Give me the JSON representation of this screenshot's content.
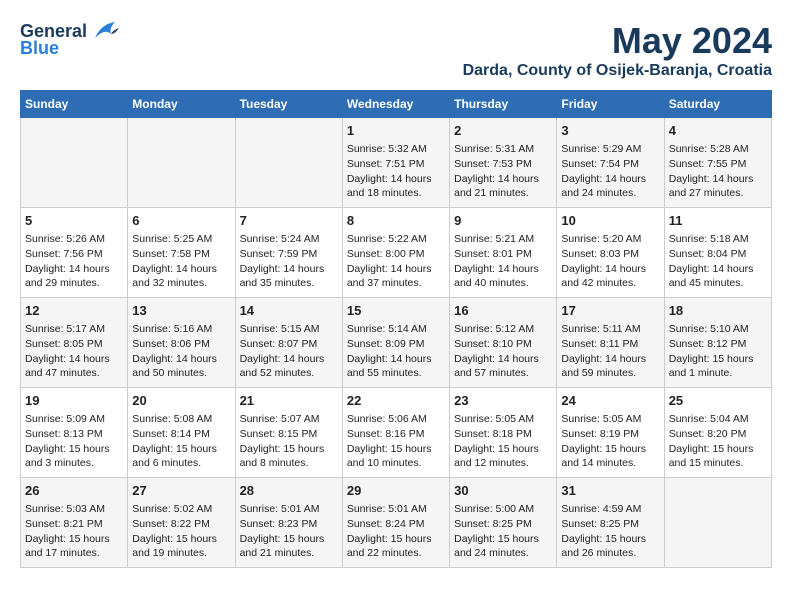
{
  "logo": {
    "general": "General",
    "blue": "Blue"
  },
  "title": {
    "month_year": "May 2024",
    "location": "Darda, County of Osijek-Baranja, Croatia"
  },
  "weekdays": [
    "Sunday",
    "Monday",
    "Tuesday",
    "Wednesday",
    "Thursday",
    "Friday",
    "Saturday"
  ],
  "weeks": [
    [
      {
        "day": "",
        "content": ""
      },
      {
        "day": "",
        "content": ""
      },
      {
        "day": "",
        "content": ""
      },
      {
        "day": "1",
        "content": "Sunrise: 5:32 AM\nSunset: 7:51 PM\nDaylight: 14 hours and 18 minutes."
      },
      {
        "day": "2",
        "content": "Sunrise: 5:31 AM\nSunset: 7:53 PM\nDaylight: 14 hours and 21 minutes."
      },
      {
        "day": "3",
        "content": "Sunrise: 5:29 AM\nSunset: 7:54 PM\nDaylight: 14 hours and 24 minutes."
      },
      {
        "day": "4",
        "content": "Sunrise: 5:28 AM\nSunset: 7:55 PM\nDaylight: 14 hours and 27 minutes."
      }
    ],
    [
      {
        "day": "5",
        "content": "Sunrise: 5:26 AM\nSunset: 7:56 PM\nDaylight: 14 hours and 29 minutes."
      },
      {
        "day": "6",
        "content": "Sunrise: 5:25 AM\nSunset: 7:58 PM\nDaylight: 14 hours and 32 minutes."
      },
      {
        "day": "7",
        "content": "Sunrise: 5:24 AM\nSunset: 7:59 PM\nDaylight: 14 hours and 35 minutes."
      },
      {
        "day": "8",
        "content": "Sunrise: 5:22 AM\nSunset: 8:00 PM\nDaylight: 14 hours and 37 minutes."
      },
      {
        "day": "9",
        "content": "Sunrise: 5:21 AM\nSunset: 8:01 PM\nDaylight: 14 hours and 40 minutes."
      },
      {
        "day": "10",
        "content": "Sunrise: 5:20 AM\nSunset: 8:03 PM\nDaylight: 14 hours and 42 minutes."
      },
      {
        "day": "11",
        "content": "Sunrise: 5:18 AM\nSunset: 8:04 PM\nDaylight: 14 hours and 45 minutes."
      }
    ],
    [
      {
        "day": "12",
        "content": "Sunrise: 5:17 AM\nSunset: 8:05 PM\nDaylight: 14 hours and 47 minutes."
      },
      {
        "day": "13",
        "content": "Sunrise: 5:16 AM\nSunset: 8:06 PM\nDaylight: 14 hours and 50 minutes."
      },
      {
        "day": "14",
        "content": "Sunrise: 5:15 AM\nSunset: 8:07 PM\nDaylight: 14 hours and 52 minutes."
      },
      {
        "day": "15",
        "content": "Sunrise: 5:14 AM\nSunset: 8:09 PM\nDaylight: 14 hours and 55 minutes."
      },
      {
        "day": "16",
        "content": "Sunrise: 5:12 AM\nSunset: 8:10 PM\nDaylight: 14 hours and 57 minutes."
      },
      {
        "day": "17",
        "content": "Sunrise: 5:11 AM\nSunset: 8:11 PM\nDaylight: 14 hours and 59 minutes."
      },
      {
        "day": "18",
        "content": "Sunrise: 5:10 AM\nSunset: 8:12 PM\nDaylight: 15 hours and 1 minute."
      }
    ],
    [
      {
        "day": "19",
        "content": "Sunrise: 5:09 AM\nSunset: 8:13 PM\nDaylight: 15 hours and 3 minutes."
      },
      {
        "day": "20",
        "content": "Sunrise: 5:08 AM\nSunset: 8:14 PM\nDaylight: 15 hours and 6 minutes."
      },
      {
        "day": "21",
        "content": "Sunrise: 5:07 AM\nSunset: 8:15 PM\nDaylight: 15 hours and 8 minutes."
      },
      {
        "day": "22",
        "content": "Sunrise: 5:06 AM\nSunset: 8:16 PM\nDaylight: 15 hours and 10 minutes."
      },
      {
        "day": "23",
        "content": "Sunrise: 5:05 AM\nSunset: 8:18 PM\nDaylight: 15 hours and 12 minutes."
      },
      {
        "day": "24",
        "content": "Sunrise: 5:05 AM\nSunset: 8:19 PM\nDaylight: 15 hours and 14 minutes."
      },
      {
        "day": "25",
        "content": "Sunrise: 5:04 AM\nSunset: 8:20 PM\nDaylight: 15 hours and 15 minutes."
      }
    ],
    [
      {
        "day": "26",
        "content": "Sunrise: 5:03 AM\nSunset: 8:21 PM\nDaylight: 15 hours and 17 minutes."
      },
      {
        "day": "27",
        "content": "Sunrise: 5:02 AM\nSunset: 8:22 PM\nDaylight: 15 hours and 19 minutes."
      },
      {
        "day": "28",
        "content": "Sunrise: 5:01 AM\nSunset: 8:23 PM\nDaylight: 15 hours and 21 minutes."
      },
      {
        "day": "29",
        "content": "Sunrise: 5:01 AM\nSunset: 8:24 PM\nDaylight: 15 hours and 22 minutes."
      },
      {
        "day": "30",
        "content": "Sunrise: 5:00 AM\nSunset: 8:25 PM\nDaylight: 15 hours and 24 minutes."
      },
      {
        "day": "31",
        "content": "Sunrise: 4:59 AM\nSunset: 8:25 PM\nDaylight: 15 hours and 26 minutes."
      },
      {
        "day": "",
        "content": ""
      }
    ]
  ]
}
